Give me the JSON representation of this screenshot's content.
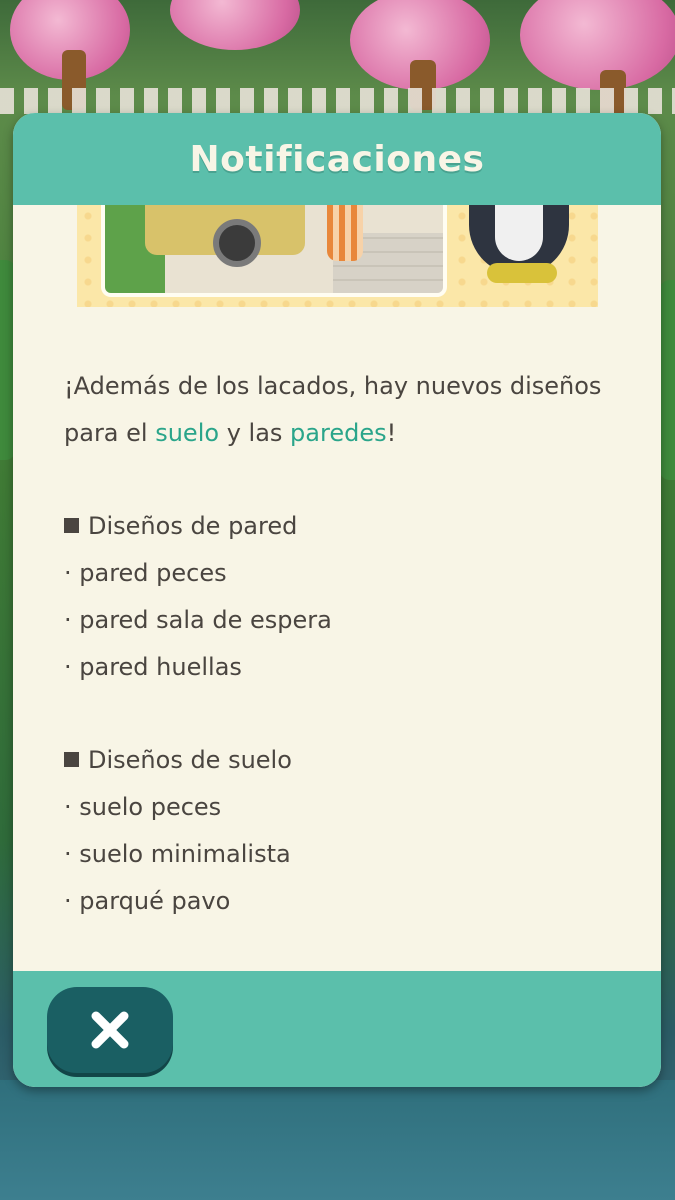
{
  "dialog": {
    "title": "Notificaciones",
    "intro": {
      "part1": "¡Además de los lacados, hay nuevos diseños para el ",
      "suelo": "suelo",
      "part2": " y las ",
      "paredes": "paredes",
      "part3": "!"
    },
    "wall_section": {
      "heading": "Diseños de pared",
      "items": [
        "· pared peces",
        "· pared sala de espera",
        "· pared huellas"
      ]
    },
    "floor_section": {
      "heading": "Diseños de suelo",
      "items": [
        "· suelo peces",
        "· suelo minimalista",
        "· parqué pavo"
      ]
    },
    "close_icon": "close-icon"
  },
  "colors": {
    "header": "#5bbfab",
    "panel": "#f8f5e6",
    "highlight": "#2aa58a",
    "close_button": "#1a5f63"
  }
}
